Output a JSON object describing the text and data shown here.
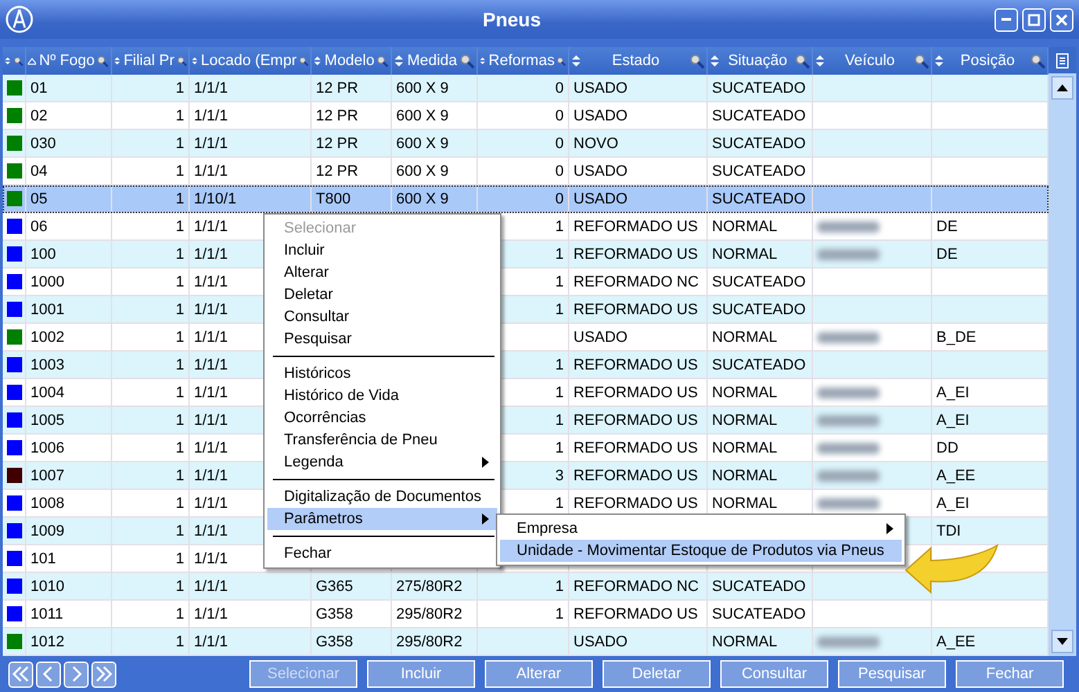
{
  "window": {
    "title": "Pneus"
  },
  "columns": [
    {
      "label": "Nº Fogo",
      "sorted": true
    },
    {
      "label": "Filial Pr",
      "sorted": false
    },
    {
      "label": "Locado (Empr",
      "sorted": false
    },
    {
      "label": "Modelo",
      "sorted": false
    },
    {
      "label": "Medida",
      "sorted": false
    },
    {
      "label": "Reformas",
      "sorted": false
    },
    {
      "label": "Estado",
      "sorted": false
    },
    {
      "label": "Situação",
      "sorted": false
    },
    {
      "label": "Veículo",
      "sorted": false
    },
    {
      "label": "Posição",
      "sorted": false
    }
  ],
  "rows": [
    {
      "color": "#008000",
      "selected": false,
      "fogo": "01",
      "filial": "1",
      "locado": "1/1/1",
      "modelo": "12 PR",
      "medida": "600 X 9",
      "reformas": "0",
      "estado": "USADO",
      "situacao": "SUCATEADO",
      "vehicle_blurred": false
    },
    {
      "color": "#008000",
      "selected": false,
      "fogo": "02",
      "filial": "1",
      "locado": "1/1/1",
      "modelo": "12 PR",
      "medida": "600 X 9",
      "reformas": "0",
      "estado": "USADO",
      "situacao": "SUCATEADO",
      "vehicle_blurred": false
    },
    {
      "color": "#008000",
      "selected": false,
      "fogo": "030",
      "filial": "1",
      "locado": "1/1/1",
      "modelo": "12 PR",
      "medida": "600 X 9",
      "reformas": "0",
      "estado": "NOVO",
      "situacao": "SUCATEADO",
      "vehicle_blurred": false
    },
    {
      "color": "#008000",
      "selected": false,
      "fogo": "04",
      "filial": "1",
      "locado": "1/1/1",
      "modelo": "12 PR",
      "medida": "600 X 9",
      "reformas": "0",
      "estado": "USADO",
      "situacao": "SUCATEADO",
      "vehicle_blurred": false
    },
    {
      "color": "#008000",
      "selected": true,
      "fogo": "05",
      "filial": "1",
      "locado": "1/10/1",
      "modelo": "T800",
      "medida": "600 X 9",
      "reformas": "0",
      "estado": "USADO",
      "situacao": "SUCATEADO",
      "vehicle_blurred": false
    },
    {
      "color": "#0000ff",
      "selected": false,
      "fogo": "06",
      "filial": "1",
      "locado": "1/1/1",
      "reformas": "1",
      "estado": "REFORMADO US",
      "situacao": "NORMAL",
      "vehicle_blurred": true,
      "posicao": "DE"
    },
    {
      "color": "#0000ff",
      "selected": false,
      "fogo": "100",
      "filial": "1",
      "locado": "1/1/1",
      "reformas": "1",
      "estado": "REFORMADO US",
      "situacao": "NORMAL",
      "vehicle_blurred": true,
      "posicao": "DE"
    },
    {
      "color": "#0000ff",
      "selected": false,
      "fogo": "1000",
      "filial": "1",
      "locado": "1/1/1",
      "reformas": "1",
      "estado": "REFORMADO NC",
      "situacao": "SUCATEADO",
      "vehicle_blurred": false
    },
    {
      "color": "#0000ff",
      "selected": false,
      "fogo": "1001",
      "filial": "1",
      "locado": "1/1/1",
      "reformas": "1",
      "estado": "REFORMADO US",
      "situacao": "SUCATEADO",
      "vehicle_blurred": false
    },
    {
      "color": "#008000",
      "selected": false,
      "fogo": "1002",
      "filial": "1",
      "locado": "1/1/1",
      "estado": "USADO",
      "situacao": "NORMAL",
      "vehicle_blurred": true,
      "posicao": "B_DE"
    },
    {
      "color": "#0000ff",
      "selected": false,
      "fogo": "1003",
      "filial": "1",
      "locado": "1/1/1",
      "reformas": "1",
      "estado": "REFORMADO US",
      "situacao": "SUCATEADO",
      "vehicle_blurred": false
    },
    {
      "color": "#0000ff",
      "selected": false,
      "fogo": "1004",
      "filial": "1",
      "locado": "1/1/1",
      "reformas": "1",
      "estado": "REFORMADO US",
      "situacao": "NORMAL",
      "vehicle_blurred": true,
      "posicao": "A_EI"
    },
    {
      "color": "#0000ff",
      "selected": false,
      "fogo": "1005",
      "filial": "1",
      "locado": "1/1/1",
      "reformas": "1",
      "estado": "REFORMADO US",
      "situacao": "NORMAL",
      "vehicle_blurred": true,
      "posicao": "A_EI"
    },
    {
      "color": "#0000ff",
      "selected": false,
      "fogo": "1006",
      "filial": "1",
      "locado": "1/1/1",
      "reformas": "1",
      "estado": "REFORMADO US",
      "situacao": "NORMAL",
      "vehicle_blurred": true,
      "posicao": "DD"
    },
    {
      "color": "#400000",
      "selected": false,
      "fogo": "1007",
      "filial": "1",
      "locado": "1/1/1",
      "reformas": "3",
      "estado": "REFORMADO US",
      "situacao": "NORMAL",
      "vehicle_blurred": true,
      "posicao": "A_EE"
    },
    {
      "color": "#0000ff",
      "selected": false,
      "fogo": "1008",
      "filial": "1",
      "locado": "1/1/1",
      "reformas": "1",
      "estado": "REFORMADO US",
      "situacao": "NORMAL",
      "vehicle_blurred": true,
      "posicao": "A_EI"
    },
    {
      "color": "#0000ff",
      "selected": false,
      "fogo": "1009",
      "filial": "1",
      "locado": "1/1/1",
      "vehicle_blurred": false,
      "posicao": "TDI"
    },
    {
      "color": "#0000ff",
      "selected": false,
      "fogo": "101",
      "filial": "1",
      "locado": "1/1/1",
      "vehicle_blurred": false
    },
    {
      "color": "#0000ff",
      "selected": false,
      "fogo": "1010",
      "filial": "1",
      "locado": "1/1/1",
      "modelo": "G365",
      "medida": "275/80R2",
      "reformas": "1",
      "estado": "REFORMADO NC",
      "situacao": "SUCATEADO",
      "vehicle_blurred": false
    },
    {
      "color": "#0000ff",
      "selected": false,
      "fogo": "1011",
      "filial": "1",
      "locado": "1/1/1",
      "modelo": "G358",
      "medida": "295/80R2",
      "reformas": "1",
      "estado": "REFORMADO US",
      "situacao": "SUCATEADO",
      "vehicle_blurred": false
    },
    {
      "color": "#008000",
      "selected": false,
      "fogo": "1012",
      "filial": "1",
      "locado": "1/1/1",
      "modelo": "G358",
      "medida": "295/80R2",
      "estado": "USADO",
      "situacao": "NORMAL",
      "vehicle_blurred": true,
      "posicao": "A_EE"
    }
  ],
  "context_menu": [
    {
      "kind": "item",
      "label": "Selecionar",
      "disabled": true,
      "selected": false,
      "submenu": false
    },
    {
      "kind": "item",
      "label": "Incluir",
      "disabled": false,
      "selected": false,
      "submenu": false
    },
    {
      "kind": "item",
      "label": "Alterar",
      "disabled": false,
      "selected": false,
      "submenu": false
    },
    {
      "kind": "item",
      "label": "Deletar",
      "disabled": false,
      "selected": false,
      "submenu": false
    },
    {
      "kind": "item",
      "label": "Consultar",
      "disabled": false,
      "selected": false,
      "submenu": false
    },
    {
      "kind": "item",
      "label": "Pesquisar",
      "disabled": false,
      "selected": false,
      "submenu": false
    },
    {
      "kind": "separator"
    },
    {
      "kind": "item",
      "label": "Históricos",
      "disabled": false,
      "selected": false,
      "submenu": false
    },
    {
      "kind": "item",
      "label": "Histórico de Vida",
      "disabled": false,
      "selected": false,
      "submenu": false
    },
    {
      "kind": "item",
      "label": "Ocorrências",
      "disabled": false,
      "selected": false,
      "submenu": false
    },
    {
      "kind": "item",
      "label": "Transferência de Pneu",
      "disabled": false,
      "selected": false,
      "submenu": false
    },
    {
      "kind": "item",
      "label": "Legenda",
      "disabled": false,
      "selected": false,
      "submenu": true
    },
    {
      "kind": "separator"
    },
    {
      "kind": "item",
      "label": "Digitalização de Documentos",
      "disabled": false,
      "selected": false,
      "submenu": false
    },
    {
      "kind": "item",
      "label": "Parâmetros",
      "disabled": false,
      "selected": true,
      "submenu": true
    },
    {
      "kind": "separator"
    },
    {
      "kind": "item",
      "label": "Fechar",
      "disabled": false,
      "selected": false,
      "submenu": false
    }
  ],
  "submenu": [
    {
      "kind": "item",
      "label": "Empresa",
      "disabled": false,
      "selected": false,
      "submenu": true
    },
    {
      "kind": "item",
      "label": "Unidade - Movimentar Estoque de Produtos via Pneus",
      "disabled": false,
      "selected": true,
      "submenu": false
    }
  ],
  "nav_buttons": [
    {
      "kind": "first"
    },
    {
      "kind": "prev"
    },
    {
      "kind": "next"
    },
    {
      "kind": "last"
    }
  ],
  "buttons": [
    {
      "label": "Selecionar",
      "disabled": true
    },
    {
      "label": "Incluir",
      "disabled": false
    },
    {
      "label": "Alterar",
      "disabled": false
    },
    {
      "label": "Deletar",
      "disabled": false
    },
    {
      "label": "Consultar",
      "disabled": false
    },
    {
      "label": "Pesquisar",
      "disabled": false
    },
    {
      "label": "Fechar",
      "disabled": false
    }
  ]
}
